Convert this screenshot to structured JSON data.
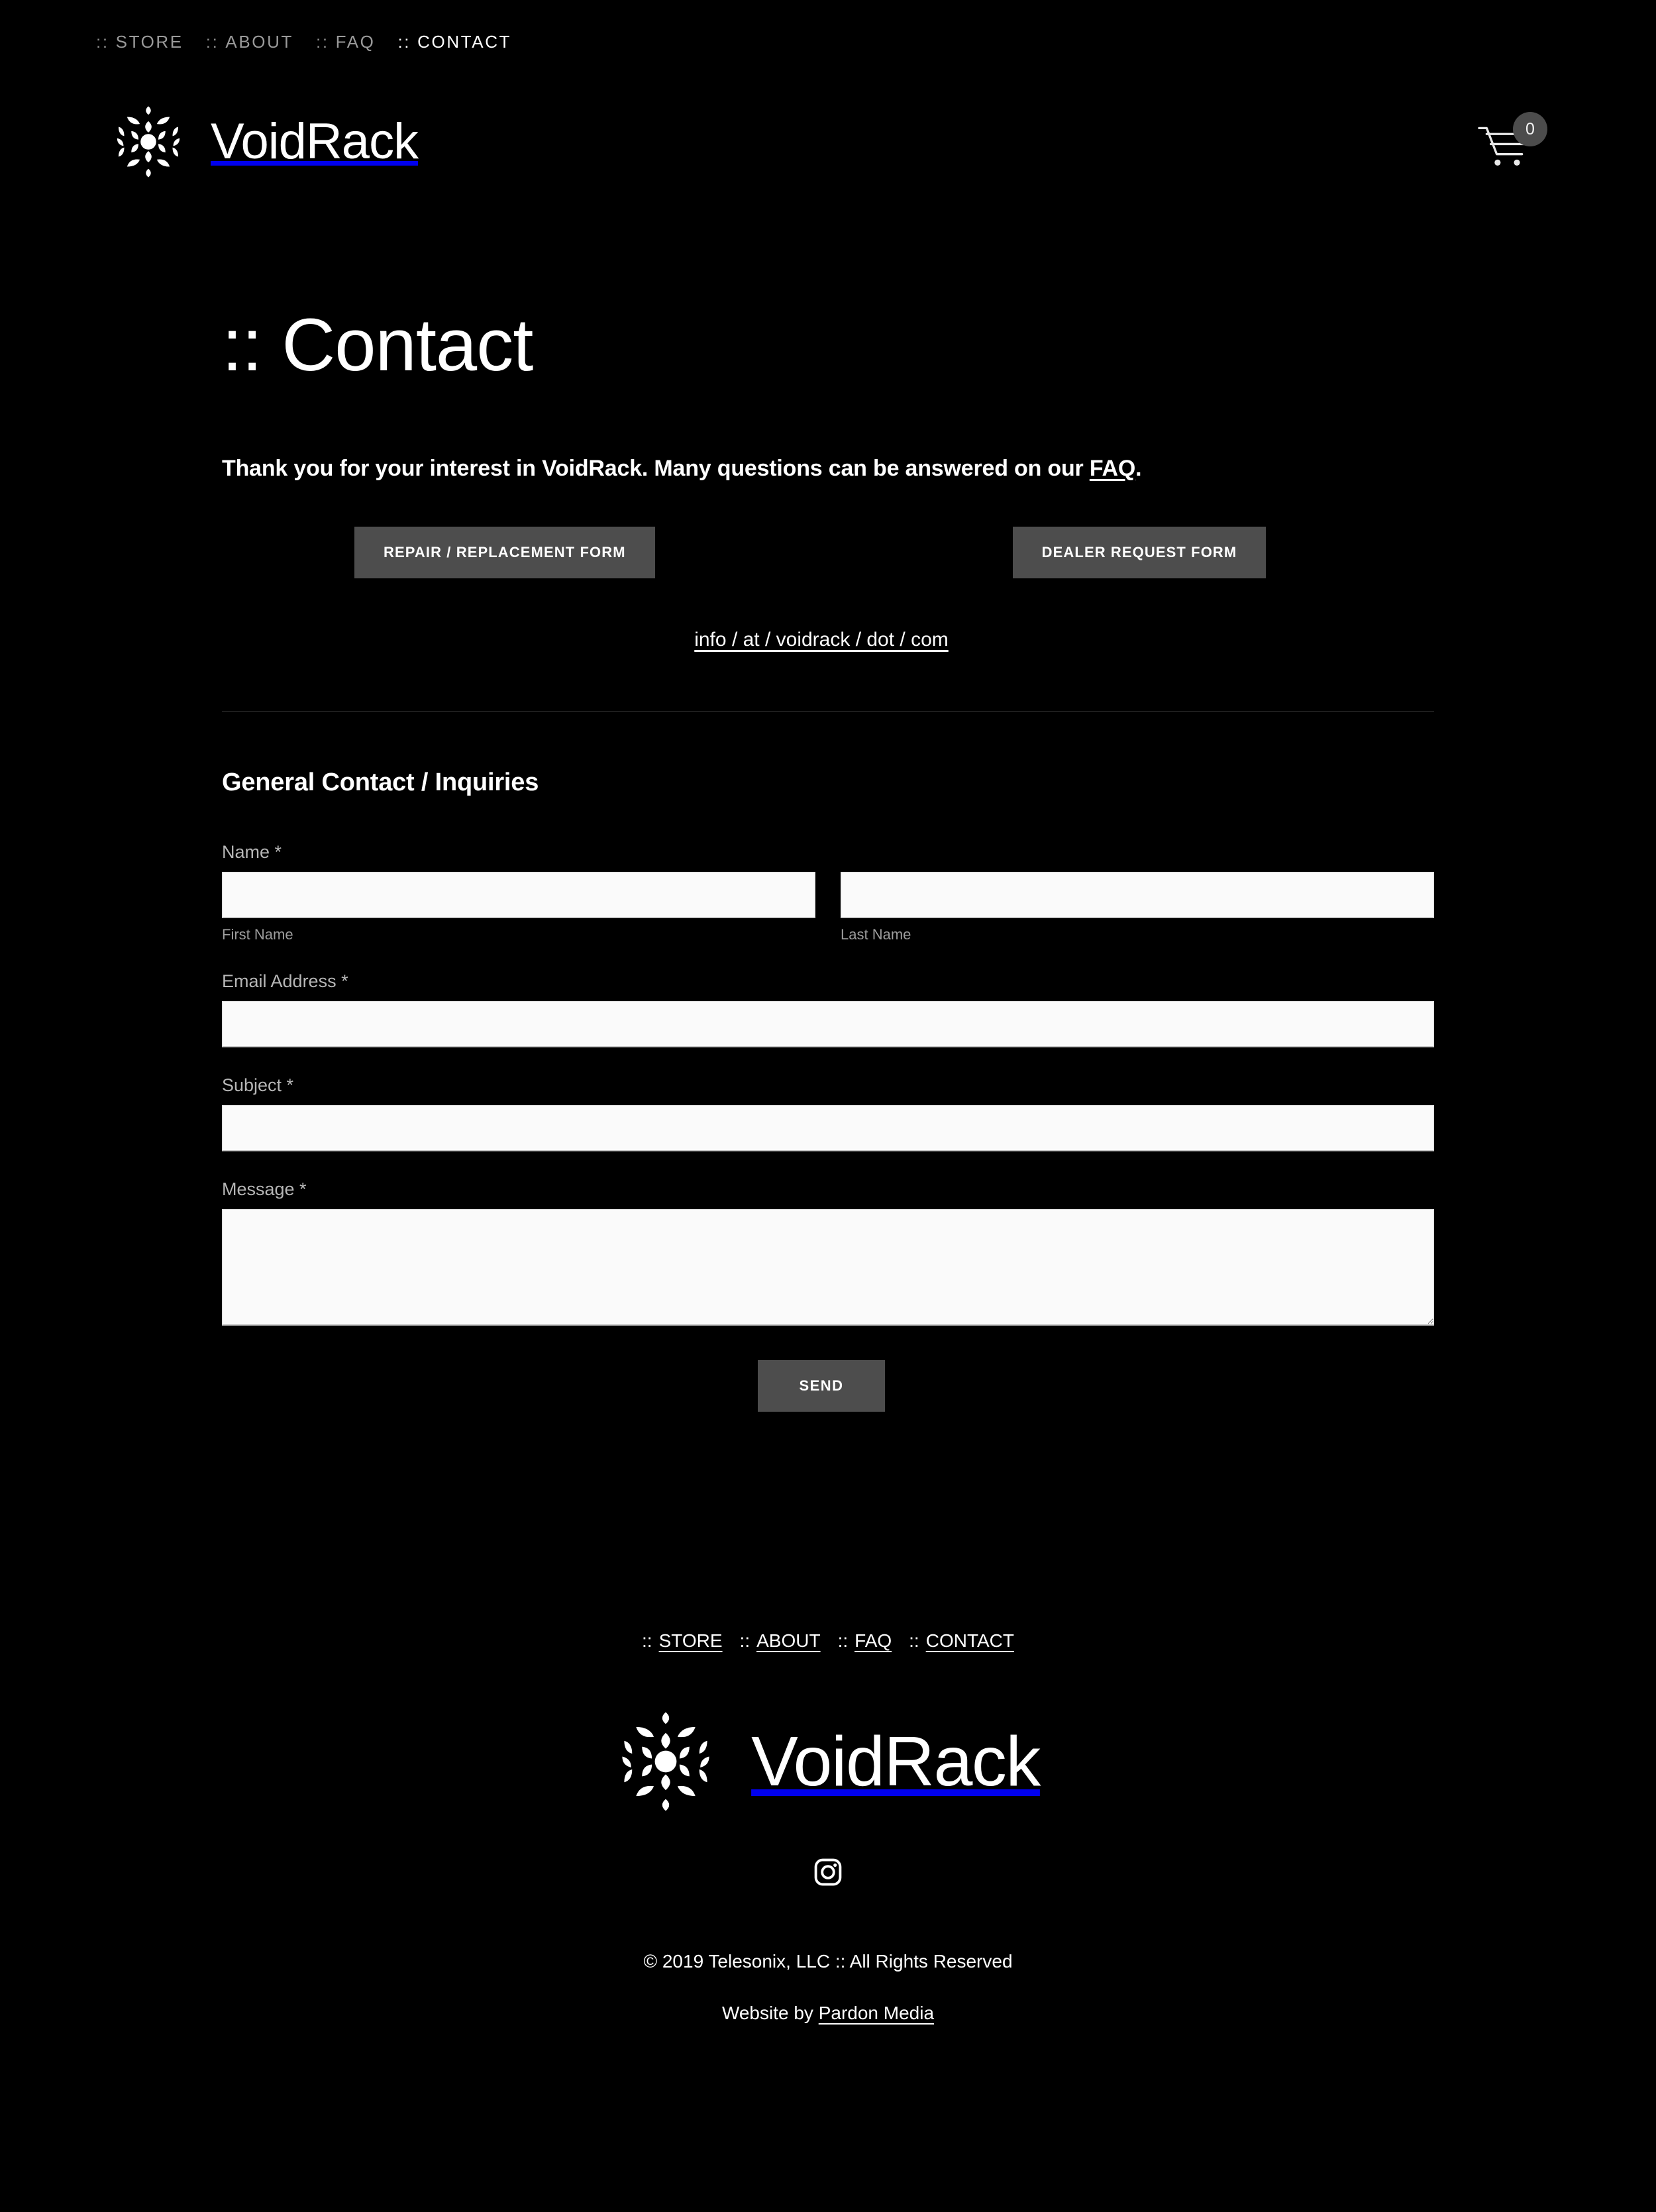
{
  "colors": {
    "background": "#000000",
    "text_primary": "#ffffff",
    "text_muted": "#9a9a9a",
    "button_gray": "#4d4d4d",
    "input_bg": "#fafafa",
    "divider": "#3b3b3b",
    "badge_gray": "#4c4c4c"
  },
  "topnav": {
    "items": [
      {
        "colons": "::",
        "label": "STORE",
        "active": false
      },
      {
        "colons": "::",
        "label": "ABOUT",
        "active": false
      },
      {
        "colons": "::",
        "label": "FAQ",
        "active": false
      },
      {
        "colons": "::",
        "label": "CONTACT",
        "active": true
      }
    ]
  },
  "header": {
    "brand_name": "VoidRack",
    "logo_icon": "voidrack-hex-logo",
    "cart_icon": "shopping-cart-icon",
    "cart_count": "0"
  },
  "main": {
    "page_title": ":: Contact",
    "intro_prefix": "Thank you for your interest in VoidRack. Many questions can be answered on our ",
    "intro_link": "FAQ",
    "intro_suffix": ".",
    "buttons": {
      "repair": "REPAIR / REPLACEMENT FORM",
      "dealer": "DEALER REQUEST FORM"
    },
    "email_link": "info / at / voidrack / dot / com",
    "form_heading": "General Contact / Inquiries"
  },
  "form": {
    "name": {
      "label": "Name *",
      "first": {
        "sub_label": "First Name",
        "value": "",
        "placeholder": ""
      },
      "last": {
        "sub_label": "Last Name",
        "value": "",
        "placeholder": ""
      }
    },
    "email": {
      "label": "Email Address *",
      "value": "",
      "placeholder": ""
    },
    "subject": {
      "label": "Subject *",
      "value": "",
      "placeholder": ""
    },
    "message": {
      "label": "Message *",
      "value": "",
      "placeholder": ""
    },
    "submit_label": "SEND"
  },
  "footer": {
    "nav": [
      {
        "colons": "::",
        "label": "STORE"
      },
      {
        "colons": "::",
        "label": "ABOUT"
      },
      {
        "colons": "::",
        "label": "FAQ"
      },
      {
        "colons": "::",
        "label": "CONTACT"
      }
    ],
    "brand_name": "VoidRack",
    "logo_icon": "voidrack-hex-logo",
    "social": [
      {
        "icon": "instagram-icon",
        "label": "Instagram"
      }
    ],
    "copyright": "© 2019 Telesonix, LLC :: All Rights Reserved",
    "credit_prefix": "Website by ",
    "credit_link": "Pardon Media"
  }
}
